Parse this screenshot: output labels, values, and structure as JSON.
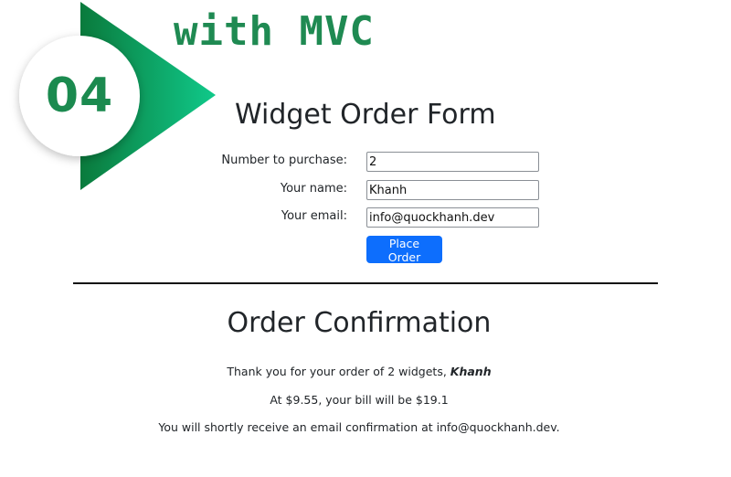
{
  "banner": {
    "title": "with MVC",
    "badge_number": "04",
    "colors": {
      "green_dark": "#0a7a3c",
      "green_light": "#10c98a"
    }
  },
  "form": {
    "title": "Widget Order Form",
    "fields": [
      {
        "label": "Number to purchase:",
        "value": "2"
      },
      {
        "label": "Your name:",
        "value": "Khanh"
      },
      {
        "label": "Your email:",
        "value": "info@quockhanh.dev"
      }
    ],
    "submit_label": "Place Order",
    "button_color": "#0d6efd"
  },
  "confirmation": {
    "title": "Order Confirmation",
    "line1_prefix": "Thank you for your order of 2 widgets, ",
    "line1_name": "Khanh",
    "line2": "At $9.55, your bill will be $19.1",
    "line3": "You will shortly receive an email confirmation at info@quockhanh.dev."
  }
}
